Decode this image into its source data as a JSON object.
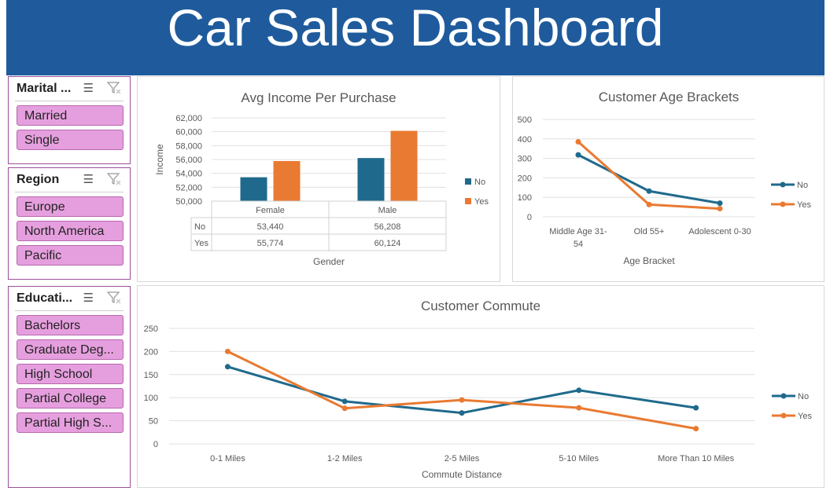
{
  "header": {
    "title": "Car Sales Dashboard"
  },
  "slicers": [
    {
      "title": "Marital ...",
      "items": [
        "Married",
        "Single"
      ]
    },
    {
      "title": "Region",
      "items": [
        "Europe",
        "North America",
        "Pacific"
      ]
    },
    {
      "title": "Educati...",
      "items": [
        "Bachelors",
        "Graduate Deg...",
        "High School",
        "Partial College",
        "Partial High S..."
      ]
    }
  ],
  "colors": {
    "header": "#1f5b9c",
    "no": "#1f6a8c",
    "yes": "#e97a32",
    "slicer_item": "#e69fde",
    "slicer_border": "#9b4f9b"
  },
  "chart_data": [
    {
      "type": "bar",
      "title": "Avg Income Per Purchase",
      "xlabel": "Gender",
      "ylabel": "Income",
      "categories": [
        "Female",
        "Male"
      ],
      "series": [
        {
          "name": "No",
          "values": [
            53440,
            56208
          ]
        },
        {
          "name": "Yes",
          "values": [
            55774,
            60124
          ]
        }
      ],
      "ylim": [
        50000,
        62000
      ],
      "yticks": [
        "50,000",
        "52,000",
        "54,000",
        "56,000",
        "58,000",
        "60,000",
        "62,000"
      ],
      "data_table": [
        {
          "name": "No",
          "values": [
            "53,440",
            "56,208"
          ]
        },
        {
          "name": "Yes",
          "values": [
            "55,774",
            "60,124"
          ]
        }
      ],
      "legend": "right"
    },
    {
      "type": "line",
      "title": "Customer Age Brackets",
      "xlabel": "Age Bracket",
      "ylabel": "",
      "categories": [
        "Middle Age 31-54",
        "Old 55+",
        "Adolescent 0-30"
      ],
      "category_lines": [
        [
          "Middle Age 31-",
          "54"
        ],
        [
          "Old 55+"
        ],
        [
          "Adolescent 0-30"
        ]
      ],
      "series": [
        {
          "name": "No",
          "values": [
            318,
            132,
            70
          ]
        },
        {
          "name": "Yes",
          "values": [
            385,
            63,
            42
          ]
        }
      ],
      "ylim": [
        0,
        500
      ],
      "yticks": [
        "0",
        "100",
        "200",
        "300",
        "400",
        "500"
      ],
      "legend": "right"
    },
    {
      "type": "line",
      "title": "Customer Commute",
      "xlabel": "Commute Distance",
      "ylabel": "",
      "categories": [
        "0-1 Miles",
        "1-2 Miles",
        "2-5 Miles",
        "5-10 Miles",
        "More Than 10 Miles"
      ],
      "series": [
        {
          "name": "No",
          "values": [
            167,
            92,
            67,
            116,
            78
          ]
        },
        {
          "name": "Yes",
          "values": [
            200,
            77,
            95,
            78,
            33
          ]
        }
      ],
      "ylim": [
        0,
        250
      ],
      "yticks": [
        "0",
        "50",
        "100",
        "150",
        "200",
        "250"
      ],
      "legend": "right"
    }
  ]
}
